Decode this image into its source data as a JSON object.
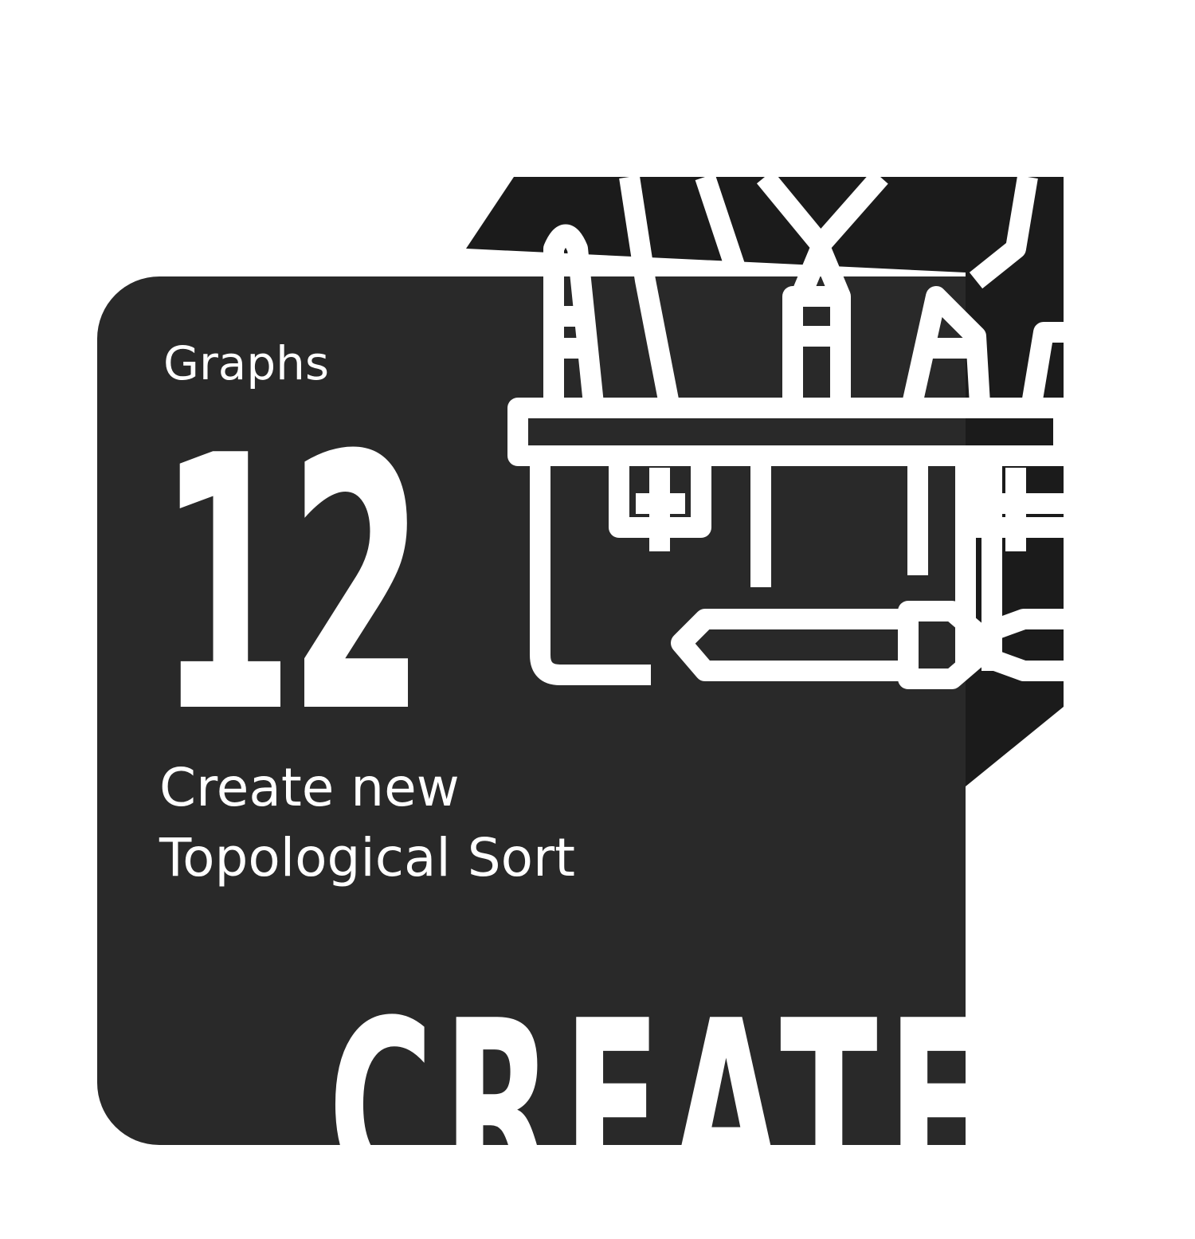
{
  "card": {
    "category": "Graphs",
    "count": "12",
    "title_line1": "Create new",
    "title_line2": "Topological Sort",
    "watermark": "CREATE"
  },
  "icons": {
    "illustration": "toolbox-icon"
  },
  "colors": {
    "card_background": "#292929",
    "icon_background": "#1b1b1b",
    "text": "#ffffff",
    "page_background": "#ffffff"
  }
}
